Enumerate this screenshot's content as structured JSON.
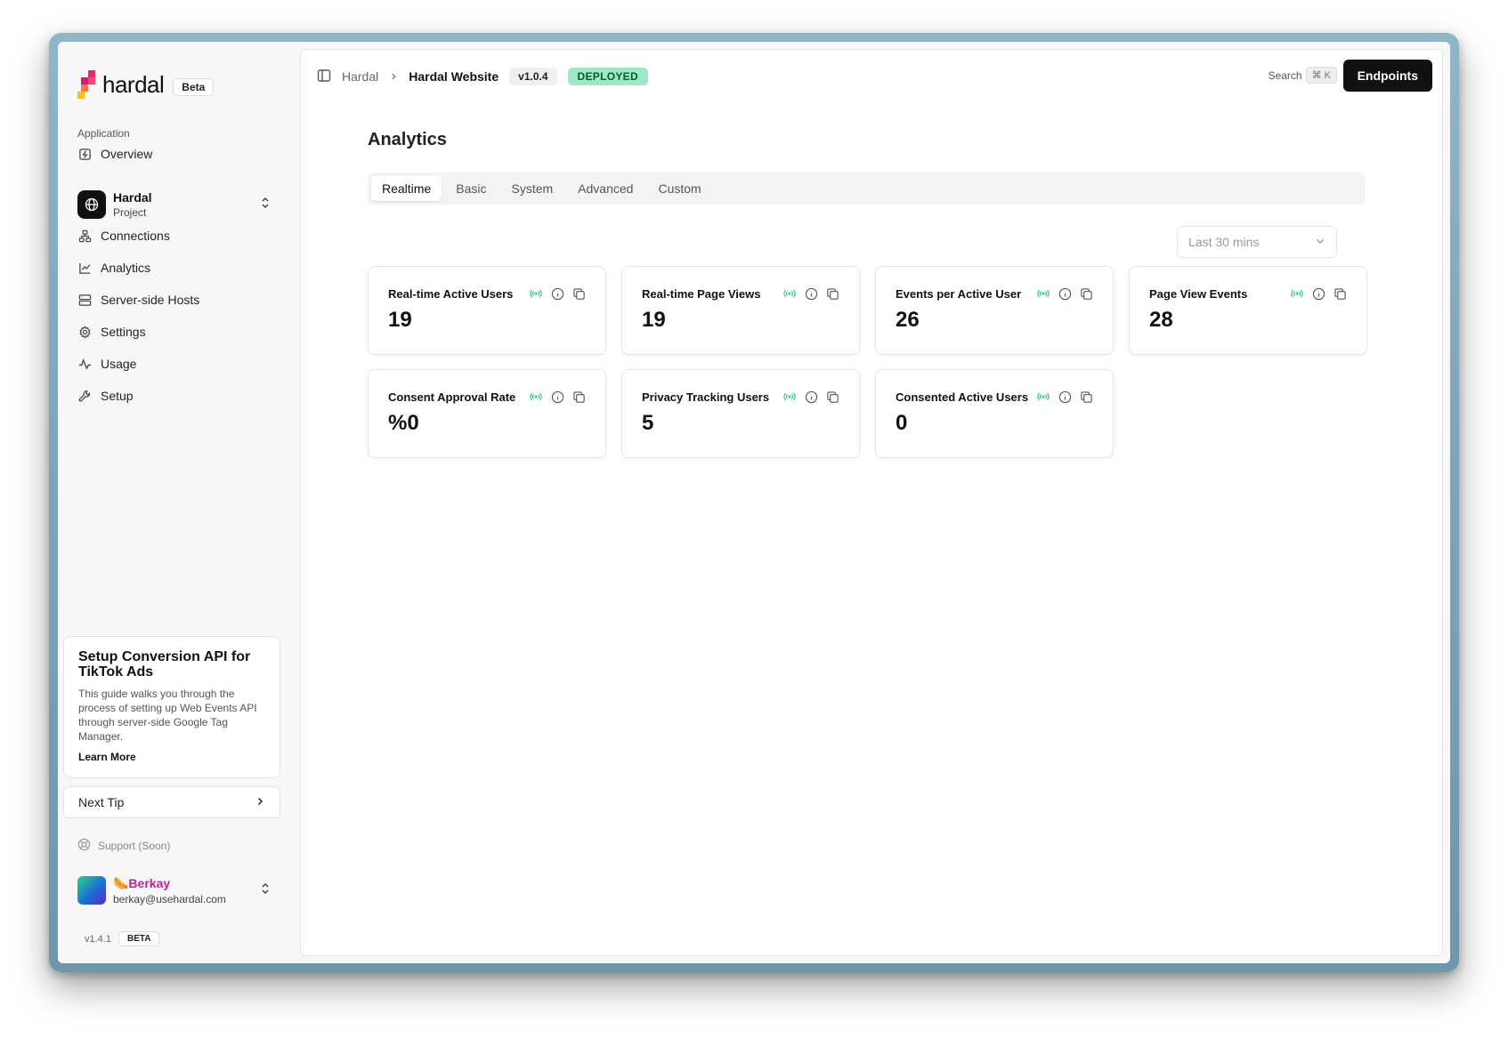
{
  "brand": {
    "name": "hardal",
    "badge": "Beta"
  },
  "sidebar": {
    "section_label": "Application",
    "overview_label": "Overview",
    "project": {
      "name": "Hardal",
      "subtitle": "Project"
    },
    "items": [
      {
        "label": "Connections",
        "icon": "connections-icon"
      },
      {
        "label": "Analytics",
        "icon": "chart-line-icon"
      },
      {
        "label": "Server-side Hosts",
        "icon": "server-icon"
      },
      {
        "label": "Settings",
        "icon": "gear-icon"
      },
      {
        "label": "Usage",
        "icon": "activity-icon"
      },
      {
        "label": "Setup",
        "icon": "wrench-icon"
      }
    ],
    "tip": {
      "title": "Setup Conversion API for TikTok Ads",
      "body": "This guide walks you through the process of setting up Web Events API through server-side Google Tag Manager.",
      "link": "Learn More"
    },
    "next_tip": "Next Tip",
    "support": "Support (Soon)",
    "user": {
      "name": "🌭Berkay",
      "email": "berkay@usehardal.com"
    },
    "version": "v1.4.1",
    "version_badge": "BETA"
  },
  "topbar": {
    "crumb_root": "Hardal",
    "crumb_current": "Hardal Website",
    "version": "v1.0.4",
    "status": "DEPLOYED",
    "search_label": "Search",
    "search_kbd": "⌘ K",
    "endpoints_label": "Endpoints"
  },
  "main": {
    "title": "Analytics",
    "tabs": [
      "Realtime",
      "Basic",
      "System",
      "Advanced",
      "Custom"
    ],
    "active_tab": "Realtime",
    "time_range": "Last 30 mins",
    "cards": [
      {
        "title": "Real-time Active Users",
        "value": "19"
      },
      {
        "title": "Real-time Page Views",
        "value": "19"
      },
      {
        "title": "Events per Active User",
        "value": "26"
      },
      {
        "title": "Page View Events",
        "value": "28"
      },
      {
        "title": "Consent Approval Rate",
        "value": "%0"
      },
      {
        "title": "Privacy Tracking Users",
        "value": "5"
      },
      {
        "title": "Consented Active Users",
        "value": "0"
      }
    ]
  },
  "colors": {
    "deployed_bg": "#9fe8c5",
    "accent_dark": "#111111",
    "live_green": "#27c47a",
    "user_name": "#c21fa0"
  }
}
